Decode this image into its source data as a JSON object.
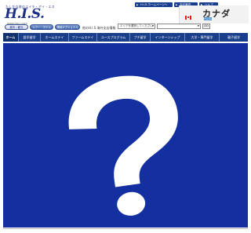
{
  "logo": {
    "tagline": "たしかな旅のエイチ・アイ・エス",
    "name": "H.I.S.",
    "sub": "www.his-j.com"
  },
  "top_links": [
    "H.I.S.ホームページへ",
    "会社案内",
    "ヘルプ"
  ],
  "country": {
    "name": "カナダ",
    "site_label": "支店情報"
  },
  "sub_tabs": [
    "都市・観光",
    "ツアー・ホテル",
    "現地オプショナル"
  ],
  "info_text": "他のH.I.S.海外支店情報",
  "area_select": {
    "placeholder": "エリアを選択してください",
    "go_label": "GO"
  },
  "main_nav": [
    "ホーム",
    "語学留学",
    "ホームステイ",
    "ファームステイ",
    "ユースプログラム",
    "プチ留学",
    "インターンシップ",
    "大学・専門留学",
    "親子留学"
  ],
  "main_panel": {
    "icon": "question-mark-icon",
    "background": "#132fa0",
    "icon_color": "#ffffff"
  }
}
